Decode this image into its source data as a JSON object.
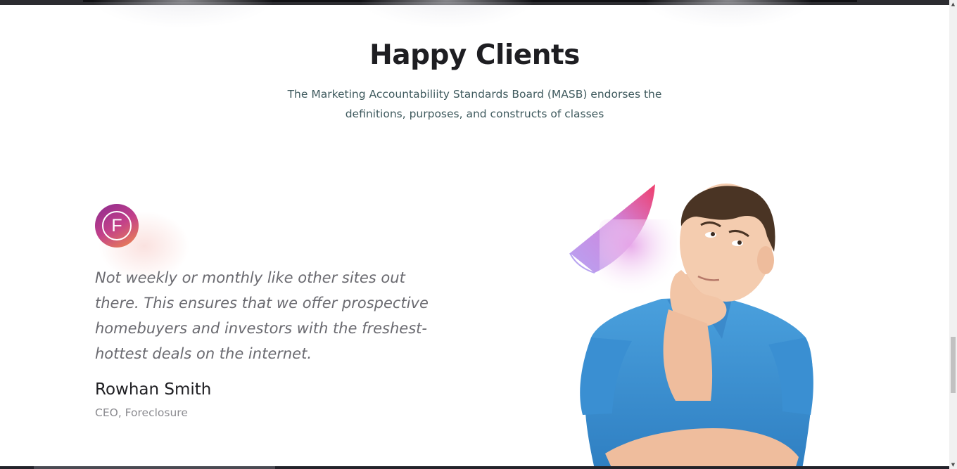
{
  "section": {
    "title": "Happy Clients",
    "subtitle": "The Marketing Accountabiliity Standards Board (MASB) endorses the definitions, purposes, and constructs of classes"
  },
  "testimonial": {
    "logo_letter": "F",
    "logo_icon": "foreclosure-logo-icon",
    "quote": "Not weekly or monthly like other sites out there. This ensures that we offer prospective homebuyers and investors with the freshest-hottest deals on the internet.",
    "author": "Rowhan Smith",
    "role": "CEO, Foreclosure"
  },
  "colors": {
    "title": "#1e1e22",
    "subtitle": "#3f5a5e",
    "quote": "#6a6a70",
    "role": "#8a8a8f",
    "logo_gradient_start": "#8c2b8f",
    "logo_gradient_end": "#f08b4b",
    "shirt": "#3f95d6"
  },
  "scrollbar": {
    "up_icon": "scroll-up-arrow-icon",
    "down_icon": "scroll-down-arrow-icon"
  }
}
